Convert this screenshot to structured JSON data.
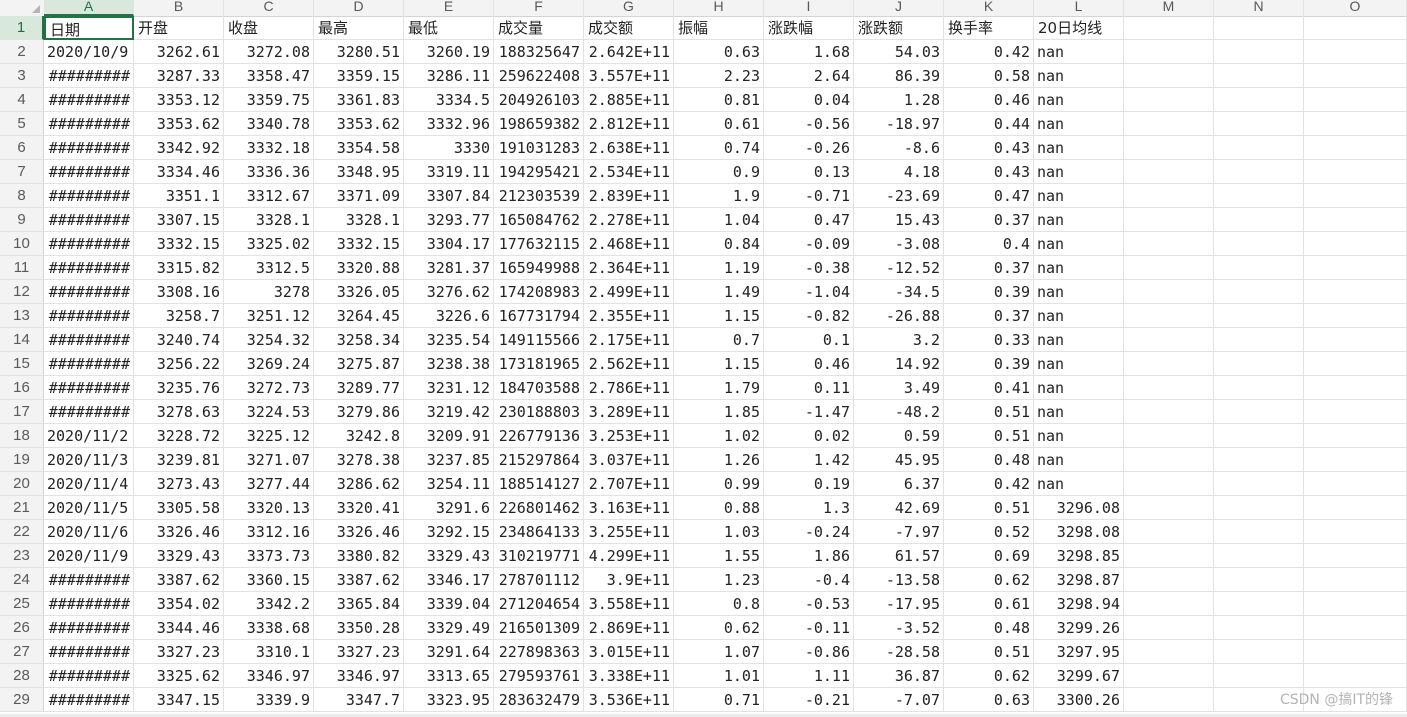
{
  "columns": [
    "A",
    "B",
    "C",
    "D",
    "E",
    "F",
    "G",
    "H",
    "I",
    "J",
    "K",
    "L",
    "M",
    "N",
    "O"
  ],
  "selected_column": "A",
  "selected_row": "1",
  "header_row": [
    "日期",
    "开盘",
    "收盘",
    "最高",
    "最低",
    "成交量",
    "成交额",
    "振幅",
    "涨跌幅",
    "涨跌额",
    "换手率",
    "20日均线"
  ],
  "rows": [
    {
      "n": "2",
      "c": [
        "2020/10/9",
        "3262.61",
        "3272.08",
        "3280.51",
        "3260.19",
        "188325647",
        "2.642E+11",
        "0.63",
        "1.68",
        "54.03",
        "0.42",
        "nan"
      ]
    },
    {
      "n": "3",
      "c": [
        "#########",
        "3287.33",
        "3358.47",
        "3359.15",
        "3286.11",
        "259622408",
        "3.557E+11",
        "2.23",
        "2.64",
        "86.39",
        "0.58",
        "nan"
      ]
    },
    {
      "n": "4",
      "c": [
        "#########",
        "3353.12",
        "3359.75",
        "3361.83",
        "3334.5",
        "204926103",
        "2.885E+11",
        "0.81",
        "0.04",
        "1.28",
        "0.46",
        "nan"
      ]
    },
    {
      "n": "5",
      "c": [
        "#########",
        "3353.62",
        "3340.78",
        "3353.62",
        "3332.96",
        "198659382",
        "2.812E+11",
        "0.61",
        "-0.56",
        "-18.97",
        "0.44",
        "nan"
      ]
    },
    {
      "n": "6",
      "c": [
        "#########",
        "3342.92",
        "3332.18",
        "3354.58",
        "3330",
        "191031283",
        "2.638E+11",
        "0.74",
        "-0.26",
        "-8.6",
        "0.43",
        "nan"
      ]
    },
    {
      "n": "7",
      "c": [
        "#########",
        "3334.46",
        "3336.36",
        "3348.95",
        "3319.11",
        "194295421",
        "2.534E+11",
        "0.9",
        "0.13",
        "4.18",
        "0.43",
        "nan"
      ]
    },
    {
      "n": "8",
      "c": [
        "#########",
        "3351.1",
        "3312.67",
        "3371.09",
        "3307.84",
        "212303539",
        "2.839E+11",
        "1.9",
        "-0.71",
        "-23.69",
        "0.47",
        "nan"
      ]
    },
    {
      "n": "9",
      "c": [
        "#########",
        "3307.15",
        "3328.1",
        "3328.1",
        "3293.77",
        "165084762",
        "2.278E+11",
        "1.04",
        "0.47",
        "15.43",
        "0.37",
        "nan"
      ]
    },
    {
      "n": "10",
      "c": [
        "#########",
        "3332.15",
        "3325.02",
        "3332.15",
        "3304.17",
        "177632115",
        "2.468E+11",
        "0.84",
        "-0.09",
        "-3.08",
        "0.4",
        "nan"
      ]
    },
    {
      "n": "11",
      "c": [
        "#########",
        "3315.82",
        "3312.5",
        "3320.88",
        "3281.37",
        "165949988",
        "2.364E+11",
        "1.19",
        "-0.38",
        "-12.52",
        "0.37",
        "nan"
      ]
    },
    {
      "n": "12",
      "c": [
        "#########",
        "3308.16",
        "3278",
        "3326.05",
        "3276.62",
        "174208983",
        "2.499E+11",
        "1.49",
        "-1.04",
        "-34.5",
        "0.39",
        "nan"
      ]
    },
    {
      "n": "13",
      "c": [
        "#########",
        "3258.7",
        "3251.12",
        "3264.45",
        "3226.6",
        "167731794",
        "2.355E+11",
        "1.15",
        "-0.82",
        "-26.88",
        "0.37",
        "nan"
      ]
    },
    {
      "n": "14",
      "c": [
        "#########",
        "3240.74",
        "3254.32",
        "3258.34",
        "3235.54",
        "149115566",
        "2.175E+11",
        "0.7",
        "0.1",
        "3.2",
        "0.33",
        "nan"
      ]
    },
    {
      "n": "15",
      "c": [
        "#########",
        "3256.22",
        "3269.24",
        "3275.87",
        "3238.38",
        "173181965",
        "2.562E+11",
        "1.15",
        "0.46",
        "14.92",
        "0.39",
        "nan"
      ]
    },
    {
      "n": "16",
      "c": [
        "#########",
        "3235.76",
        "3272.73",
        "3289.77",
        "3231.12",
        "184703588",
        "2.786E+11",
        "1.79",
        "0.11",
        "3.49",
        "0.41",
        "nan"
      ]
    },
    {
      "n": "17",
      "c": [
        "#########",
        "3278.63",
        "3224.53",
        "3279.86",
        "3219.42",
        "230188803",
        "3.289E+11",
        "1.85",
        "-1.47",
        "-48.2",
        "0.51",
        "nan"
      ]
    },
    {
      "n": "18",
      "c": [
        "2020/11/2",
        "3228.72",
        "3225.12",
        "3242.8",
        "3209.91",
        "226779136",
        "3.253E+11",
        "1.02",
        "0.02",
        "0.59",
        "0.51",
        "nan"
      ]
    },
    {
      "n": "19",
      "c": [
        "2020/11/3",
        "3239.81",
        "3271.07",
        "3278.38",
        "3237.85",
        "215297864",
        "3.037E+11",
        "1.26",
        "1.42",
        "45.95",
        "0.48",
        "nan"
      ]
    },
    {
      "n": "20",
      "c": [
        "2020/11/4",
        "3273.43",
        "3277.44",
        "3286.62",
        "3254.11",
        "188514127",
        "2.707E+11",
        "0.99",
        "0.19",
        "6.37",
        "0.42",
        "nan"
      ]
    },
    {
      "n": "21",
      "c": [
        "2020/11/5",
        "3305.58",
        "3320.13",
        "3320.41",
        "3291.6",
        "226801462",
        "3.163E+11",
        "0.88",
        "1.3",
        "42.69",
        "0.51",
        "3296.08"
      ]
    },
    {
      "n": "22",
      "c": [
        "2020/11/6",
        "3326.46",
        "3312.16",
        "3326.46",
        "3292.15",
        "234864133",
        "3.255E+11",
        "1.03",
        "-0.24",
        "-7.97",
        "0.52",
        "3298.08"
      ]
    },
    {
      "n": "23",
      "c": [
        "2020/11/9",
        "3329.43",
        "3373.73",
        "3380.82",
        "3329.43",
        "310219771",
        "4.299E+11",
        "1.55",
        "1.86",
        "61.57",
        "0.69",
        "3298.85"
      ]
    },
    {
      "n": "24",
      "c": [
        "#########",
        "3387.62",
        "3360.15",
        "3387.62",
        "3346.17",
        "278701112",
        "3.9E+11",
        "1.23",
        "-0.4",
        "-13.58",
        "0.62",
        "3298.87"
      ]
    },
    {
      "n": "25",
      "c": [
        "#########",
        "3354.02",
        "3342.2",
        "3365.84",
        "3339.04",
        "271204654",
        "3.558E+11",
        "0.8",
        "-0.53",
        "-17.95",
        "0.61",
        "3298.94"
      ]
    },
    {
      "n": "26",
      "c": [
        "#########",
        "3344.46",
        "3338.68",
        "3350.28",
        "3329.49",
        "216501309",
        "2.869E+11",
        "0.62",
        "-0.11",
        "-3.52",
        "0.48",
        "3299.26"
      ]
    },
    {
      "n": "27",
      "c": [
        "#########",
        "3327.23",
        "3310.1",
        "3327.23",
        "3291.64",
        "227898363",
        "3.015E+11",
        "1.07",
        "-0.86",
        "-28.58",
        "0.51",
        "3297.95"
      ]
    },
    {
      "n": "28",
      "c": [
        "#########",
        "3325.62",
        "3346.97",
        "3346.97",
        "3313.65",
        "279593761",
        "3.338E+11",
        "1.01",
        "1.11",
        "36.87",
        "0.62",
        "3299.67"
      ]
    },
    {
      "n": "29",
      "c": [
        "#########",
        "3347.15",
        "3339.9",
        "3347.7",
        "3323.95",
        "283632479",
        "3.536E+11",
        "0.71",
        "-0.21",
        "-7.07",
        "0.63",
        "3300.26"
      ]
    }
  ],
  "watermark": "CSDN @搞IT的锋"
}
